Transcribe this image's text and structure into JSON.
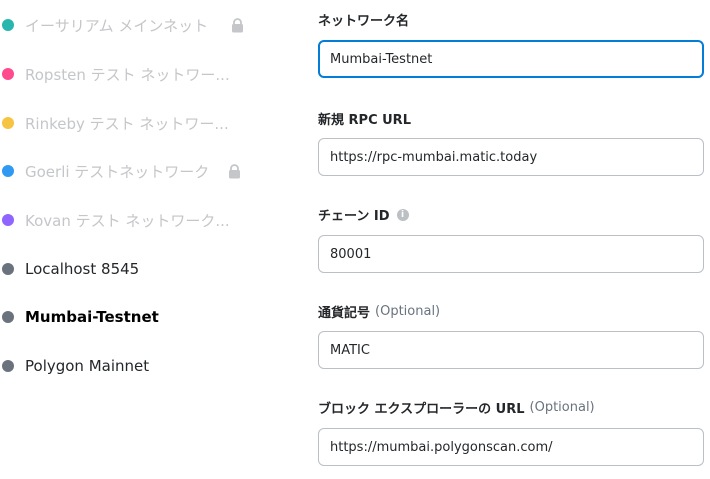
{
  "networks": [
    {
      "label": "イーサリアム メインネット",
      "color": "#29b6af",
      "faded": true,
      "locked": true
    },
    {
      "label": "Ropsten テスト ネットワー...",
      "color": "#ff4a8d",
      "faded": true,
      "locked": false
    },
    {
      "label": "Rinkeby テスト ネットワー...",
      "color": "#f6c343",
      "faded": true,
      "locked": false
    },
    {
      "label": "Goerli テストネットワーク",
      "color": "#3099f2",
      "faded": true,
      "locked": true
    },
    {
      "label": "Kovan テスト ネットワーク...",
      "color": "#9064ff",
      "faded": true,
      "locked": false
    },
    {
      "label": "Localhost 8545",
      "color": "#6a737d",
      "faded": false,
      "locked": false
    },
    {
      "label": "Mumbai-Testnet",
      "color": "#6a737d",
      "faded": false,
      "locked": false,
      "selected": true
    },
    {
      "label": "Polygon Mainnet",
      "color": "#6a737d",
      "faded": false,
      "locked": false
    }
  ],
  "form": {
    "network_name": {
      "label": "ネットワーク名",
      "value": "Mumbai-Testnet"
    },
    "rpc_url": {
      "label": "新規 RPC URL",
      "value": "https://rpc-mumbai.matic.today"
    },
    "chain_id": {
      "label": "チェーン ID",
      "info": "i",
      "value": "80001"
    },
    "currency_symbol": {
      "label": "通貨記号",
      "optional": "(Optional)",
      "value": "MATIC"
    },
    "explorer_url": {
      "label": "ブロック エクスプローラーの URL",
      "optional": "(Optional)",
      "value": "https://mumbai.polygonscan.com/"
    }
  },
  "colors": {
    "accent": "#037dd6",
    "border": "#bbc0c5",
    "faded_text": "#c4c6c9"
  }
}
